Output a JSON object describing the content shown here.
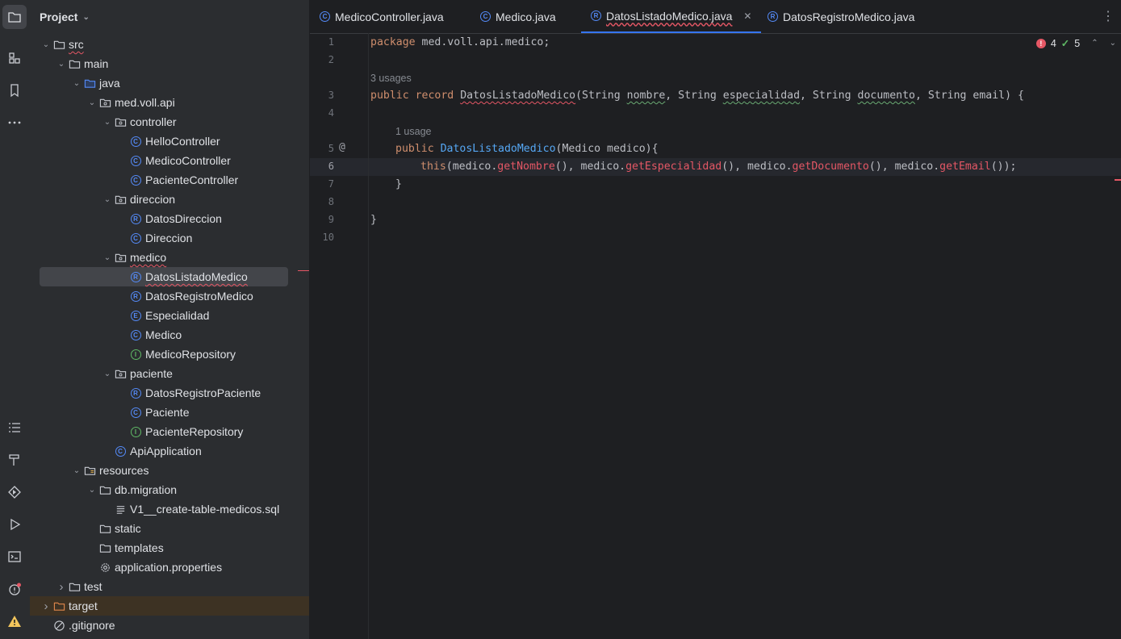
{
  "project_panel": {
    "title": "Project",
    "tree": [
      {
        "label": "src",
        "type": "folder",
        "indent": 2,
        "expanded": true,
        "squig": true
      },
      {
        "label": "main",
        "type": "folder",
        "indent": 3,
        "expanded": true
      },
      {
        "label": "java",
        "type": "folder-src",
        "indent": 4,
        "expanded": true
      },
      {
        "label": "med.voll.api",
        "type": "package",
        "indent": 5,
        "expanded": true
      },
      {
        "label": "controller",
        "type": "package",
        "indent": 6,
        "expanded": true
      },
      {
        "label": "HelloController",
        "type": "class",
        "indent": 7
      },
      {
        "label": "MedicoController",
        "type": "class",
        "indent": 7
      },
      {
        "label": "PacienteController",
        "type": "class",
        "indent": 7
      },
      {
        "label": "direccion",
        "type": "package",
        "indent": 6,
        "expanded": true
      },
      {
        "label": "DatosDireccion",
        "type": "record",
        "indent": 7
      },
      {
        "label": "Direccion",
        "type": "class",
        "indent": 7
      },
      {
        "label": "medico",
        "type": "package",
        "indent": 6,
        "expanded": true,
        "squig": true
      },
      {
        "label": "DatosListadoMedico",
        "type": "record",
        "indent": 7,
        "selected": true,
        "squig": true
      },
      {
        "label": "DatosRegistroMedico",
        "type": "record",
        "indent": 7
      },
      {
        "label": "Especialidad",
        "type": "enum",
        "indent": 7
      },
      {
        "label": "Medico",
        "type": "class",
        "indent": 7
      },
      {
        "label": "MedicoRepository",
        "type": "interface",
        "indent": 7
      },
      {
        "label": "paciente",
        "type": "package",
        "indent": 6,
        "expanded": true
      },
      {
        "label": "DatosRegistroPaciente",
        "type": "record",
        "indent": 7
      },
      {
        "label": "Paciente",
        "type": "class",
        "indent": 7
      },
      {
        "label": "PacienteRepository",
        "type": "interface",
        "indent": 7
      },
      {
        "label": "ApiApplication",
        "type": "class",
        "indent": 6
      },
      {
        "label": "resources",
        "type": "folder-res",
        "indent": 4,
        "expanded": true
      },
      {
        "label": "db.migration",
        "type": "folder",
        "indent": 5,
        "expanded": true
      },
      {
        "label": "V1__create-table-medicos.sql",
        "type": "sql",
        "indent": 6
      },
      {
        "label": "static",
        "type": "folder",
        "indent": 5
      },
      {
        "label": "templates",
        "type": "folder",
        "indent": 5
      },
      {
        "label": "application.properties",
        "type": "settings",
        "indent": 5
      },
      {
        "label": "test",
        "type": "folder",
        "indent": 3,
        "collapsed": true
      },
      {
        "label": "target",
        "type": "folder-excluded",
        "indent": 2,
        "collapsed": true,
        "excluded": true
      },
      {
        "label": ".gitignore",
        "type": "ignore",
        "indent": 2
      }
    ]
  },
  "tabs": [
    {
      "label": "MedicoController.java",
      "icon": "class-icon",
      "active": false
    },
    {
      "label": "Medico.java",
      "icon": "class-icon",
      "active": false
    },
    {
      "label": "DatosListadoMedico.java",
      "icon": "record-icon",
      "active": true
    },
    {
      "label": "DatosRegistroMedico.java",
      "icon": "record-icon",
      "active": false
    }
  ],
  "inspections": {
    "errors": "4",
    "warnings": "5"
  },
  "editor": {
    "line_numbers": [
      "1",
      "2",
      "3",
      "4",
      "5",
      "6",
      "7",
      "8",
      "9",
      "10"
    ],
    "current_line": "6",
    "hint_usages_record": "3 usages",
    "hint_usages_ctor": "1 usage",
    "lines": {
      "l1_kw": "package",
      "l1_rest": " med.voll.api.medico;",
      "l3_kw1": "public",
      "l3_kw2": "record",
      "l3_name": "DatosListadoMedico",
      "l3_p1": "(String ",
      "l3_nombre": "nombre",
      "l3_p2": ", String ",
      "l3_esp": "especialidad",
      "l3_p3": ", String ",
      "l3_doc": "documento",
      "l3_p4": ", String email) {",
      "l5_kw": "public",
      "l5_name": "DatosListadoMedico",
      "l5_rest": "(Medico medico){",
      "l6_kw": "this",
      "l6_a": "(medico.",
      "l6_m1": "getNombre",
      "l6_b": "(), medico.",
      "l6_m2": "getEspecialidad",
      "l6_c": "(), medico.",
      "l6_m3": "getDocumento",
      "l6_d": "(), medico.",
      "l6_m4": "getEmail",
      "l6_e": "());",
      "l7": "}",
      "l9": "}"
    }
  }
}
